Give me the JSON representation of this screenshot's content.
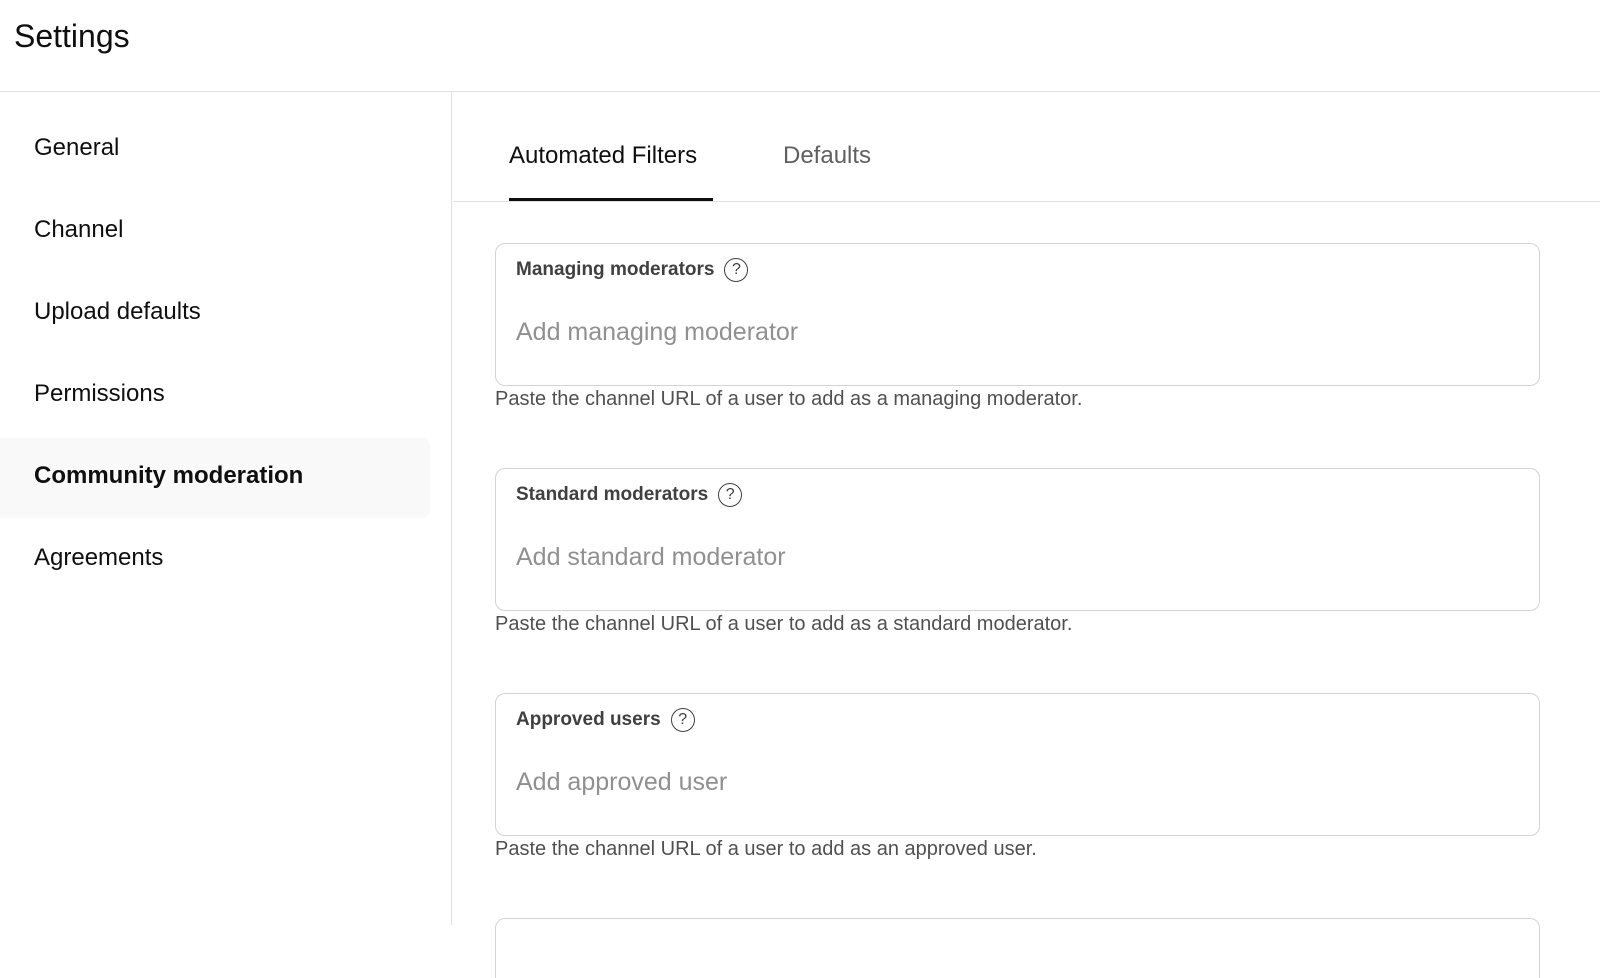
{
  "header": {
    "title": "Settings"
  },
  "sidebar": {
    "items": [
      {
        "label": "General"
      },
      {
        "label": "Channel"
      },
      {
        "label": "Upload defaults"
      },
      {
        "label": "Permissions"
      },
      {
        "label": "Community moderation",
        "active": true
      },
      {
        "label": "Agreements"
      }
    ]
  },
  "tabs": [
    {
      "label": "Automated Filters",
      "active": true
    },
    {
      "label": "Defaults",
      "active": false
    }
  ],
  "fields": [
    {
      "label": "Managing moderators",
      "placeholder": "Add managing moderator",
      "hint": "Paste the channel URL of a user to add as a managing moderator."
    },
    {
      "label": "Standard moderators",
      "placeholder": "Add standard moderator",
      "hint": "Paste the channel URL of a user to add as a standard moderator."
    },
    {
      "label": "Approved users",
      "placeholder": "Add approved user",
      "hint": "Paste the channel URL of a user to add as an approved user."
    }
  ],
  "icons": {
    "help": "help-circle-icon",
    "help_glyph": "?"
  },
  "colors": {
    "active_nav_bg": "#f9f9f9",
    "border": "#d3d3d3",
    "text": "#0f0f0f",
    "muted": "#606060"
  }
}
